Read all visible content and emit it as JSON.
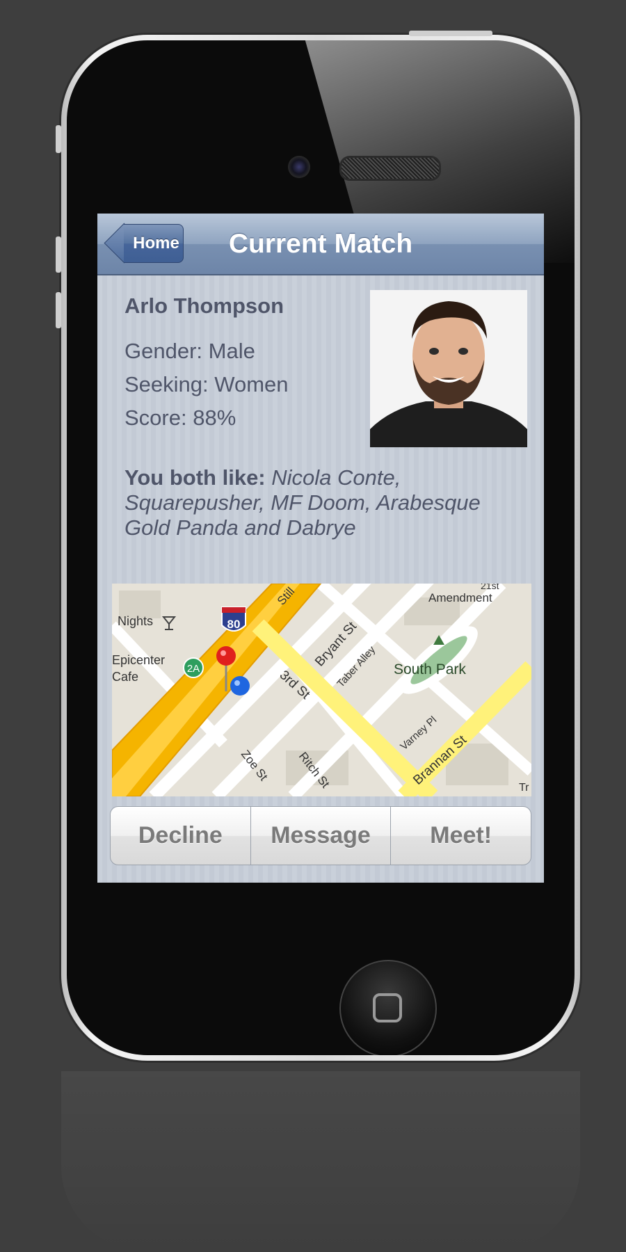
{
  "navbar": {
    "back_label": "Home",
    "title": "Current Match"
  },
  "profile": {
    "name": "Arlo Thompson",
    "gender": "Gender: Male",
    "seeking": "Seeking: Women",
    "score": "Score: 88%",
    "likes_label": "You both like:",
    "likes_value": "Nicola Conte, Squarepusher, MF Doom, Arabesque Gold Panda and Dabrye"
  },
  "map": {
    "labels": {
      "nights": "Nights",
      "epicenter": "Epicenter",
      "cafe": "Cafe",
      "interstate": "80",
      "exit": "2A",
      "bryant": "Bryant St",
      "taber": "Taber Alley",
      "third": "3rd St",
      "south_park": "South Park",
      "varney": "Varney Pl",
      "brannan": "Brannan St",
      "zoe": "Zoe St",
      "ritch": "Ritch St",
      "amendment": "Amendment",
      "twentyfirst": "21st",
      "still": "Still",
      "tr": "Tr"
    }
  },
  "actions": {
    "decline": "Decline",
    "message": "Message",
    "meet": "Meet!"
  },
  "colors": {
    "navbar": "#7990b1",
    "back_button": "#46659a",
    "screen_bg": "#c9d0da",
    "text": "#4f5569",
    "freeway": "#f5b400",
    "street": "#ffffff",
    "major_street": "#fff27a",
    "park": "#9bc79b"
  }
}
